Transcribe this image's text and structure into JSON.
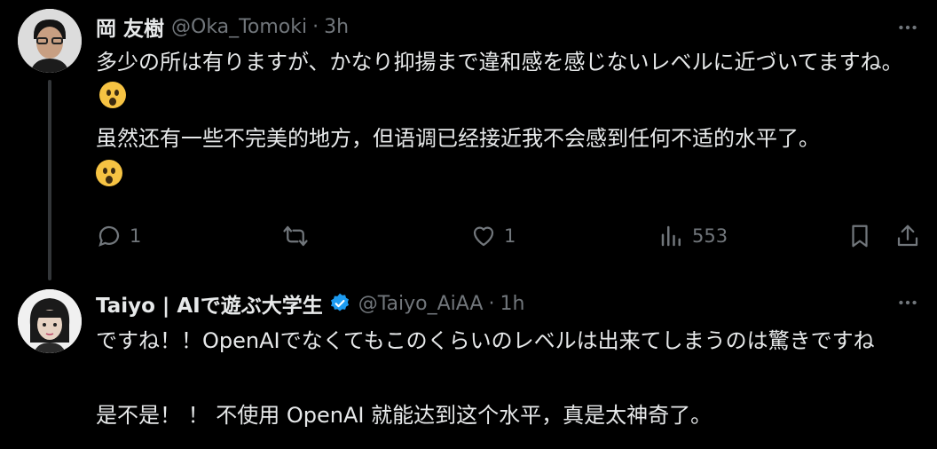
{
  "tweets": [
    {
      "author_name": "岡 友樹",
      "handle": "@Oka_Tomoki",
      "dot": "·",
      "time": "3h",
      "text_line1": "多少の所は有りますが、かなり抑揚まで違和感を感じないレベルに近づいてますね。",
      "text_line2": "虽然还有一些不完美的地方，但语调已经接近我不会感到任何不适的水平了。",
      "emoji": "astonished-face-emoji",
      "actions": {
        "reply_count": "1",
        "retweet_count": "",
        "like_count": "1",
        "views_count": "553"
      }
    },
    {
      "author_name": "Taiyo | AIで遊ぶ大学生",
      "handle": "@Taiyo_AiAA",
      "dot": "·",
      "time": "1h",
      "verified": true,
      "text_line1": "ですね！！OpenAIでなくてもこのくらいのレベルは出来てしまうのは驚きですね",
      "text_line2": "是不是！ ！ 不使用 OpenAI 就能达到这个水平，真是太神奇了。"
    }
  ],
  "icons": {
    "reply": "reply-icon",
    "retweet": "retweet-icon",
    "like": "heart-icon",
    "views": "views-icon",
    "bookmark": "bookmark-icon",
    "share": "share-icon",
    "more": "more-icon",
    "verified": "verified-badge-icon"
  },
  "colors": {
    "background": "#000000",
    "text": "#e7e9ea",
    "secondary": "#71767b",
    "verified": "#1d9bf0"
  }
}
